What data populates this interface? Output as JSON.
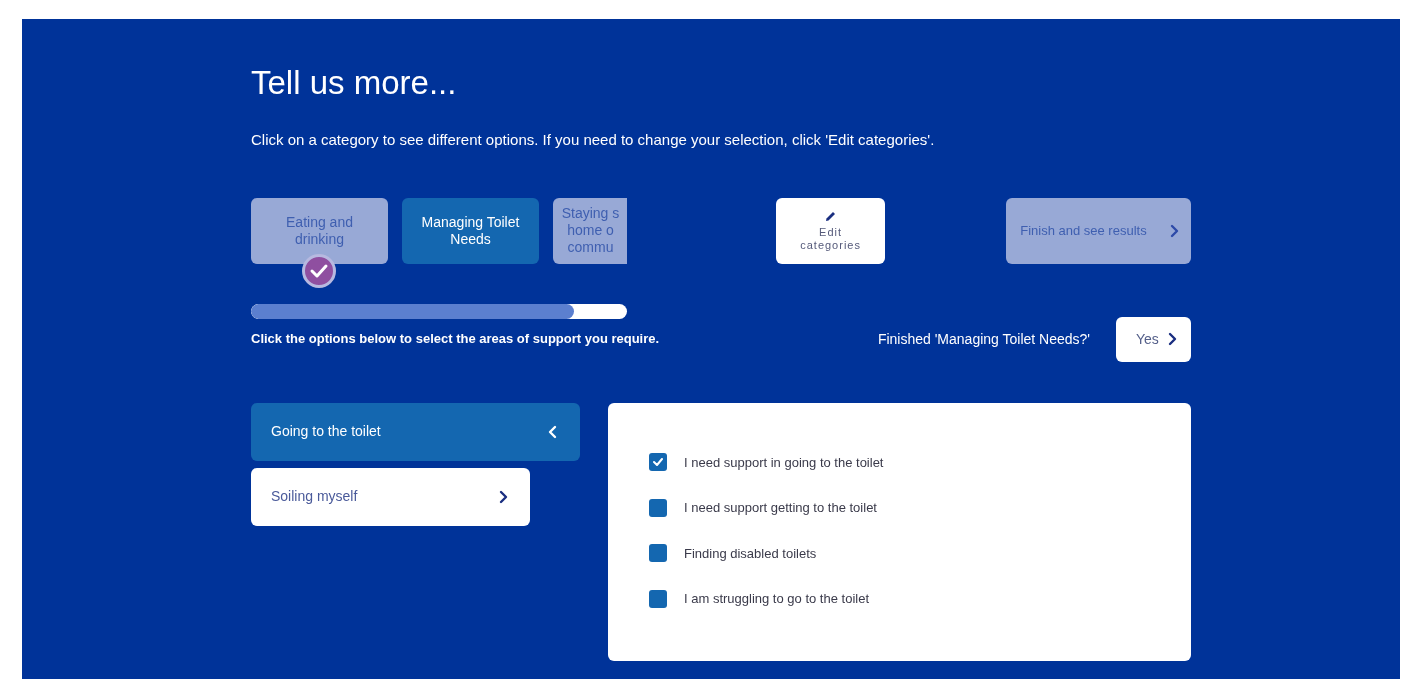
{
  "title": "Tell us more...",
  "intro": "Click on a category to see different options. If you need to change your selection, click 'Edit categories'.",
  "categories": [
    {
      "label": "Eating and\ndrinking",
      "selected": false,
      "completed": true,
      "cut": false
    },
    {
      "label": "Managing Toilet\nNeeds",
      "selected": true,
      "completed": false,
      "cut": false
    },
    {
      "label": "Staying s\nhome o\ncommu",
      "selected": false,
      "completed": false,
      "cut": true
    }
  ],
  "edit_button": {
    "label": "Edit\ncategories"
  },
  "finish_button": {
    "label": "Finish and see results",
    "disabled": true
  },
  "progress": {
    "level": 0.86
  },
  "instruction": "Click the options below to select the areas of support you require.",
  "finished_prompt": "Finished 'Managing Toilet Needs?'",
  "yes_button": {
    "label": "Yes"
  },
  "subcategories": [
    {
      "label": "Going to the toilet",
      "selected": true
    },
    {
      "label": "Soiling myself",
      "selected": false
    }
  ],
  "options": [
    {
      "label": "I need support in going to the toilet",
      "checked": true
    },
    {
      "label": "I need support getting to the toilet",
      "checked": false
    },
    {
      "label": "Finding disabled toilets",
      "checked": false
    },
    {
      "label": "I am struggling to go to the toilet",
      "checked": false
    }
  ]
}
